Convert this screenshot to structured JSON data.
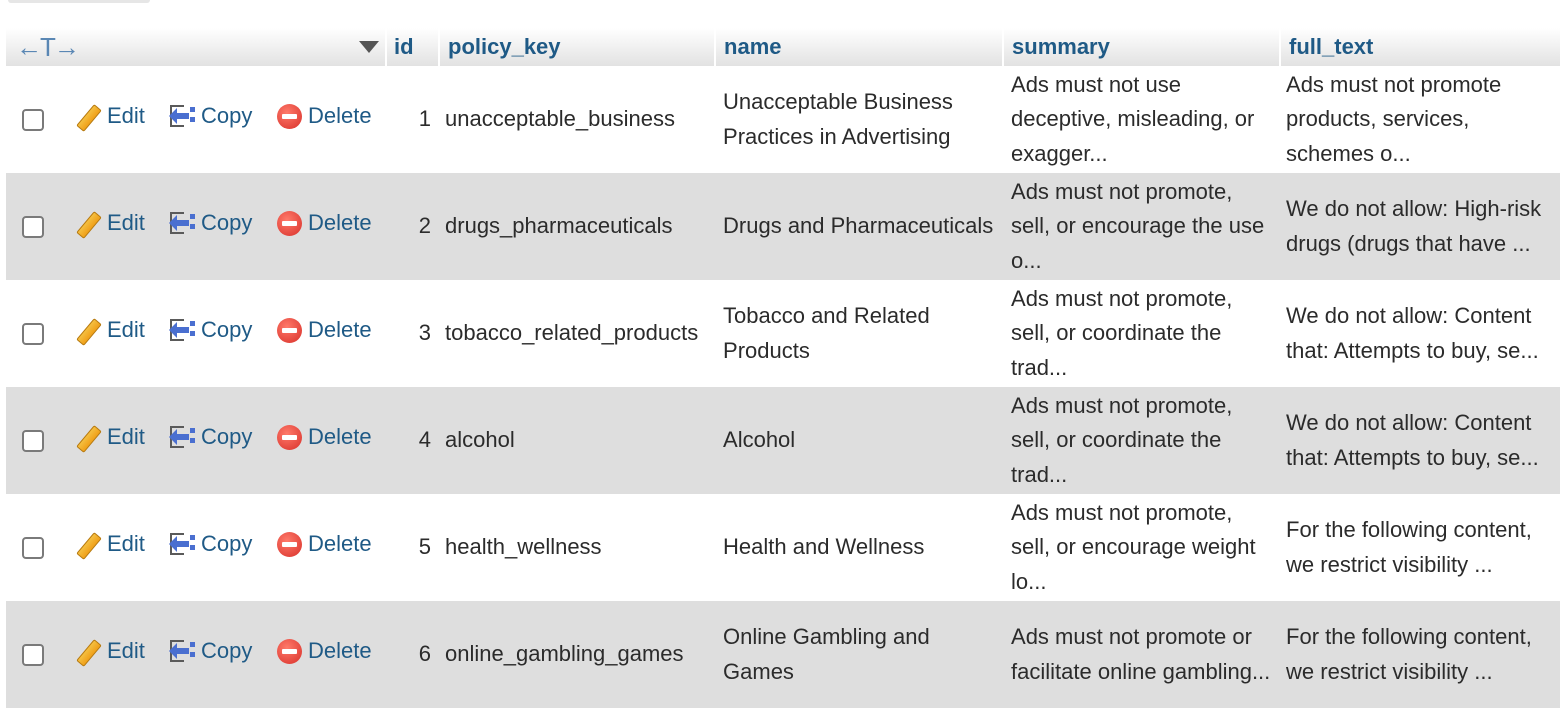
{
  "toolbar": {
    "arrows": "←T→"
  },
  "columns": {
    "id": "id",
    "policy_key": "policy_key",
    "name": "name",
    "summary": "summary",
    "full_text": "full_text"
  },
  "actions": {
    "edit": "Edit",
    "copy": "Copy",
    "delete": "Delete"
  },
  "rows": [
    {
      "id": "1",
      "policy_key": "unacceptable_business",
      "name": "Unacceptable Business Practices in Advertising",
      "summary": "Ads must not use deceptive, misleading, or exagger...",
      "full_text": "Ads must not promote products, services, schemes o..."
    },
    {
      "id": "2",
      "policy_key": "drugs_pharmaceuticals",
      "name": "Drugs and Pharmaceuticals",
      "summary": "Ads must not promote, sell, or encourage the use o...",
      "full_text": "We do not allow: High-risk drugs (drugs that have ..."
    },
    {
      "id": "3",
      "policy_key": "tobacco_related_products",
      "name": "Tobacco and Related Products",
      "summary": "Ads must not promote, sell, or coordinate the trad...",
      "full_text": "We do not allow: Content that: Attempts to buy, se..."
    },
    {
      "id": "4",
      "policy_key": "alcohol",
      "name": "Alcohol",
      "summary": "Ads must not promote, sell, or coordinate the trad...",
      "full_text": "We do not allow: Content that: Attempts to buy, se..."
    },
    {
      "id": "5",
      "policy_key": "health_wellness",
      "name": "Health and Wellness",
      "summary": "Ads must not promote, sell, or encourage weight lo...",
      "full_text": "For the following content, we restrict visibility ..."
    },
    {
      "id": "6",
      "policy_key": "online_gambling_games",
      "name": "Online Gambling and Games",
      "summary": "Ads must not promote or facilitate online gambling...",
      "full_text": "For the following content, we restrict visibility ..."
    }
  ],
  "colors": {
    "header_text": "#1f5a86",
    "link": "#1f5a86",
    "row_alt": "#dedede"
  }
}
